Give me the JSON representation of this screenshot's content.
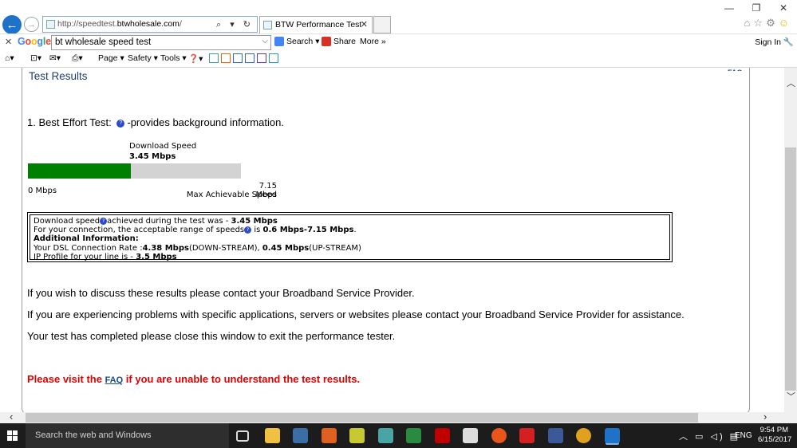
{
  "browser": {
    "address_prefix": "http://speedtest.",
    "address_domain": "btwholesale.com",
    "address_suffix": "/",
    "address_tools": "⌕ ▾ ↻",
    "tab_title": "BTW Performance Test",
    "window_controls": [
      "—",
      "❐",
      "✕"
    ]
  },
  "google_toolbar": {
    "close": "✕",
    "logo_letters": [
      {
        "ch": "G",
        "color": "#4285f4"
      },
      {
        "ch": "o",
        "color": "#ea4335"
      },
      {
        "ch": "o",
        "color": "#fbbc05"
      },
      {
        "ch": "g",
        "color": "#4285f4"
      },
      {
        "ch": "l",
        "color": "#34a853"
      },
      {
        "ch": "e",
        "color": "#ea4335"
      }
    ],
    "search_value": "bt wholesale speed test",
    "search_label": "Search",
    "share_label": "Share",
    "more_label": "More »",
    "signin_label": "Sign In"
  },
  "command_bar": {
    "page": "Page ▾",
    "safety": "Safety ▾",
    "tools": "Tools ▾",
    "help": "❓▾"
  },
  "content": {
    "faq_top": "FAQ",
    "section_title": "Test Results",
    "test_heading_prefix": "1. Best Effort Test:",
    "test_heading_suffix": "-provides background information.",
    "download_label": "Download  Speed",
    "download_value": "3.45 Mbps",
    "bar_min": "0 Mbps",
    "bar_max": "7.15 Mbps",
    "bar_max_caption": "Max Achievable Speed",
    "progress": {
      "value": 3.45,
      "max": 7.15
    },
    "info": {
      "line1_a": "Download speed",
      "line1_b": "achieved during the test was - ",
      "line1_value": "3.45 Mbps",
      "line2_a": "For your connection, the acceptable range of speeds",
      "line2_b": " is ",
      "line2_value": "0.6 Mbps-7.15 Mbps",
      "line2_end": ".",
      "line3": "Additional Information:",
      "line4_a": "Your DSL Connection Rate :",
      "line4_down": "4.38 Mbps",
      "line4_down_label": "(DOWN-STREAM), ",
      "line4_up": "0.45 Mbps",
      "line4_up_label": "(UP-STREAM)",
      "line5_a": "IP Profile for your line is - ",
      "line5_value": "3.5 Mbps"
    },
    "para1": "If you wish to discuss these results please contact your Broadband Service Provider.",
    "para2": "If you are experiencing problems with specific applications, servers or websites please contact your Broadband Service Provider for assistance.",
    "para3": "Your test has completed please close this window to exit the performance tester.",
    "visit_a": "Please visit the ",
    "visit_link": "FAQ",
    "visit_b": " if you are unable to understand the test results."
  },
  "taskbar": {
    "search_placeholder": "Search the web and Windows",
    "tray_icons": "︿ ▭ ◁) ▤",
    "lang": "ENG",
    "time": "9:54 PM",
    "date": "6/15/2017",
    "app_colors": [
      "#1c1c1c",
      "#f0c040",
      "#3a6ea5",
      "#e06020",
      "#c8c830",
      "#49a4a4",
      "#2a8a40",
      "#c00000",
      "#dddddd",
      "#e8561c",
      "#d42020",
      "#3b5998",
      "#e0a020",
      "#1e73c8"
    ]
  }
}
